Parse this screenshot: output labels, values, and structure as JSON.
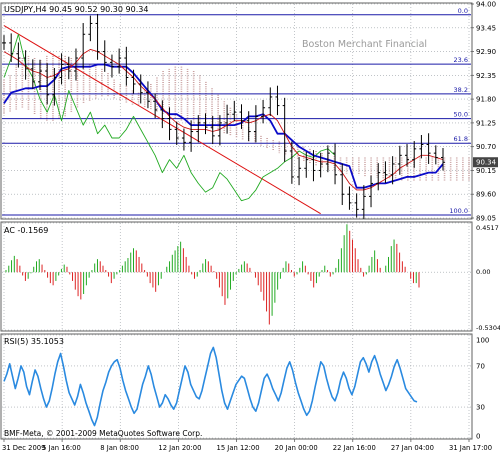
{
  "chart_data": {
    "type": "line",
    "title": "USDJPY,H4  90.45 90.52 90.30 90.34",
    "watermark": "Boston Merchant Financial",
    "copyright": "BMF-Meta, © 2001-2009 MetaQuotes Software Corp.",
    "x_labels": [
      "31 Dec 2009",
      "5 Jan 16:00",
      "8 Jan 08:00",
      "12 Jan 20:00",
      "15 Jan 12:00",
      "20 Jan 00:00",
      "22 Jan 16:00",
      "27 Jan 04:00",
      "31 Jan 17:00"
    ],
    "colors": {
      "background": "#ffffff",
      "grid": "#9aa0a6",
      "price_line": "#000000",
      "fib_level": "#1a1aa8",
      "kijun": "#0a0ac8",
      "tenkan": "#cc1111",
      "chikou": "#22aa22",
      "cloud": "#c9a0a0",
      "trendline": "#dd1111",
      "ac_up": "#22aa22",
      "ac_down": "#dd2222",
      "rsi": "#2a8ae0",
      "current_price_tag": "#444444"
    },
    "panels": {
      "price": {
        "ylim": [
          89.05,
          94.0
        ],
        "y_ticks": [
          "94.00",
          "93.45",
          "92.90",
          "92.35",
          "91.80",
          "91.25",
          "90.70",
          "90.15",
          "89.60",
          "89.05"
        ],
        "y_tick_values": [
          94.0,
          93.45,
          92.9,
          92.35,
          91.8,
          91.25,
          90.7,
          90.15,
          89.6,
          89.05
        ],
        "current_price": "90.34",
        "current_price_value": 90.34,
        "fib_levels": [
          {
            "label": "0.0",
            "price": 93.75
          },
          {
            "label": "23.6",
            "price": 92.61
          },
          {
            "label": "38.2",
            "price": 91.92
          },
          {
            "label": "50.0",
            "price": 91.35
          },
          {
            "label": "61.8",
            "price": 90.78
          },
          {
            "label": "100.0",
            "price": 89.12
          }
        ],
        "close": [
          93.1,
          92.85,
          92.75,
          92.5,
          92.2,
          92.45,
          91.9,
          92.3,
          92.6,
          92.45,
          92.75,
          93.3,
          93.55,
          92.9,
          92.65,
          92.55,
          92.75,
          92.3,
          92.15,
          91.95,
          91.75,
          91.55,
          91.35,
          91.1,
          90.9,
          90.8,
          91.05,
          91.25,
          91.15,
          90.95,
          91.25,
          91.45,
          91.5,
          91.3,
          91.05,
          91.4,
          91.6,
          91.85,
          91.65,
          90.6,
          90.0,
          90.2,
          90.4,
          90.15,
          90.3,
          90.55,
          90.05,
          89.6,
          89.4,
          89.25,
          89.55,
          89.85,
          90.1,
          90.05,
          90.3,
          90.5,
          90.4,
          90.65,
          90.75,
          90.55,
          90.45,
          90.34
        ],
        "tenkan": [
          92.9,
          92.8,
          92.7,
          92.55,
          92.45,
          92.4,
          92.3,
          92.35,
          92.45,
          92.5,
          92.65,
          92.85,
          92.95,
          92.9,
          92.8,
          92.7,
          92.6,
          92.45,
          92.3,
          92.1,
          91.95,
          91.8,
          91.6,
          91.4,
          91.25,
          91.15,
          91.1,
          91.1,
          91.1,
          91.05,
          91.1,
          91.2,
          91.3,
          91.3,
          91.25,
          91.3,
          91.4,
          91.45,
          91.3,
          91.0,
          90.7,
          90.5,
          90.45,
          90.4,
          90.35,
          90.35,
          90.3,
          90.1,
          89.85,
          89.7,
          89.7,
          89.75,
          89.85,
          89.95,
          90.05,
          90.2,
          90.3,
          90.4,
          90.5,
          90.5,
          90.45,
          90.4
        ],
        "kijun": [
          91.7,
          91.95,
          92.0,
          92.05,
          92.05,
          92.1,
          92.1,
          92.25,
          92.5,
          92.55,
          92.55,
          92.55,
          92.55,
          92.6,
          92.6,
          92.55,
          92.55,
          92.55,
          92.4,
          92.2,
          92.0,
          91.8,
          91.55,
          91.45,
          91.45,
          91.35,
          91.2,
          91.2,
          91.2,
          91.2,
          91.2,
          91.2,
          91.2,
          91.25,
          91.4,
          91.4,
          91.45,
          91.3,
          91.0,
          91.0,
          90.85,
          90.7,
          90.6,
          90.5,
          90.45,
          90.4,
          90.35,
          90.3,
          90.25,
          89.75,
          89.75,
          89.8,
          89.85,
          89.85,
          89.9,
          89.95,
          90.0,
          90.0,
          90.05,
          90.1,
          90.1,
          90.3
        ],
        "chikou": [
          92.3,
          92.75,
          93.3,
          92.6,
          92.3,
          91.8,
          91.5,
          91.9,
          91.3,
          92.0,
          91.6,
          91.2,
          91.5,
          91.0,
          91.2,
          90.9,
          90.9,
          91.1,
          91.4,
          91.1,
          90.8,
          90.5,
          90.1,
          90.4,
          90.2,
          90.5,
          90.1,
          89.85,
          89.65,
          89.75,
          90.1,
          89.95,
          89.7,
          89.45,
          89.5,
          89.7,
          90.0,
          90.1,
          90.2,
          90.35,
          90.45,
          90.6,
          90.5,
          90.45,
          90.6,
          90.65,
          90.5
        ],
        "cloud_upper": [
          92.25,
          92.35,
          92.6,
          92.75,
          92.8,
          92.75,
          92.7,
          92.8,
          92.85,
          92.8,
          92.8,
          92.75,
          92.7,
          92.55,
          92.6,
          92.55,
          92.5,
          92.4,
          92.25,
          92.15,
          92.1,
          92.0,
          91.95,
          92.0,
          92.15,
          92.3,
          92.45,
          92.5,
          92.55,
          92.55,
          92.5,
          92.45,
          92.35,
          92.2,
          92.05,
          91.9,
          91.75,
          91.6,
          91.45,
          91.3,
          91.15,
          91.05,
          90.95,
          90.9,
          90.85,
          90.82,
          90.8,
          90.78,
          90.75,
          90.7,
          90.65,
          90.6,
          90.55,
          90.5,
          90.48,
          90.45,
          90.45,
          90.45,
          90.45,
          90.45,
          90.45,
          90.45,
          90.45,
          90.45,
          90.45,
          90.45,
          90.45,
          90.45,
          90.45,
          90.45,
          90.45,
          90.45,
          90.45,
          90.45,
          90.45,
          90.45,
          90.45
        ],
        "cloud_lower": [
          91.45,
          91.5,
          91.55,
          91.6,
          91.55,
          91.45,
          91.35,
          91.3,
          91.3,
          91.35,
          91.4,
          91.5,
          91.6,
          91.7,
          91.75,
          91.8,
          91.85,
          91.85,
          91.8,
          91.75,
          91.7,
          91.65,
          91.65,
          91.6,
          91.55,
          91.5,
          91.45,
          91.4,
          91.35,
          91.3,
          91.25,
          91.2,
          91.2,
          91.15,
          91.1,
          91.05,
          91.0,
          90.95,
          90.9,
          90.85,
          90.8,
          90.75,
          90.7,
          90.65,
          90.6,
          90.55,
          90.5,
          90.45,
          90.4,
          90.35,
          90.3,
          90.25,
          90.2,
          90.15,
          90.12,
          90.1,
          90.08,
          90.06,
          90.04,
          90.02,
          90.0,
          89.98,
          89.96,
          89.94,
          89.93,
          89.92,
          89.91,
          89.9,
          89.9,
          89.9,
          89.9,
          89.9,
          89.9,
          89.9,
          89.9,
          89.9,
          89.9
        ],
        "trendline": {
          "start": [
            0,
            93.5
          ],
          "end": [
            44,
            89.15
          ]
        }
      },
      "ac": {
        "label": "AC -0.1569",
        "ylim": [
          -0.5304,
          0.4517
        ],
        "y_ticks": [
          "0.4517",
          "0.00",
          "-0.5304"
        ],
        "y_tick_values": [
          0.4517,
          0.0,
          -0.5304
        ],
        "values": [
          0.02,
          0.06,
          0.11,
          0.15,
          0.12,
          0.06,
          -0.03,
          -0.08,
          -0.06,
          -0.01,
          0.05,
          0.1,
          0.12,
          0.07,
          0.02,
          -0.05,
          -0.1,
          -0.12,
          -0.08,
          -0.03,
          0.03,
          0.07,
          0.05,
          -0.02,
          -0.08,
          -0.16,
          -0.22,
          -0.25,
          -0.2,
          -0.12,
          -0.05,
          0.02,
          0.08,
          0.12,
          0.1,
          0.06,
          0.02,
          -0.04,
          -0.1,
          -0.06,
          -0.02,
          0.02,
          0.06,
          0.1,
          0.13,
          0.18,
          0.22,
          0.2,
          0.14,
          0.08,
          0.02,
          -0.04,
          -0.1,
          -0.14,
          -0.18,
          -0.12,
          -0.06,
          0.0,
          0.05,
          0.1,
          0.16,
          0.2,
          0.24,
          0.28,
          0.22,
          0.14,
          0.06,
          -0.02,
          -0.06,
          -0.04,
          0.02,
          0.08,
          0.12,
          0.1,
          0.06,
          0.01,
          -0.06,
          -0.14,
          -0.22,
          -0.3,
          -0.24,
          -0.16,
          -0.08,
          -0.02,
          0.03,
          0.07,
          0.1,
          0.08,
          0.04,
          0.0,
          -0.05,
          -0.12,
          -0.18,
          -0.26,
          -0.36,
          -0.48,
          -0.4,
          -0.28,
          -0.16,
          -0.06,
          0.04,
          0.1,
          0.08,
          0.02,
          -0.04,
          -0.02,
          0.04,
          0.1,
          0.06,
          -0.02,
          -0.08,
          -0.14,
          -0.1,
          -0.04,
          0.02,
          0.06,
          0.02,
          -0.04,
          -0.02,
          0.04,
          0.12,
          0.22,
          0.34,
          0.44,
          0.38,
          0.3,
          0.22,
          0.12,
          0.04,
          -0.04,
          -0.02,
          0.06,
          0.14,
          0.2,
          0.12,
          0.04,
          0.0,
          0.06,
          0.14,
          0.24,
          0.3,
          0.26,
          0.18,
          0.1,
          0.05,
          0.0,
          -0.06,
          -0.1,
          -0.1,
          -0.14
        ]
      },
      "rsi": {
        "label": "RSI(5) 35.1053",
        "ylim": [
          0,
          100
        ],
        "y_ticks": [
          "100",
          "70",
          "30",
          "0"
        ],
        "y_tick_values": [
          100,
          70,
          30,
          0
        ],
        "values": [
          55,
          62,
          72,
          60,
          48,
          58,
          70,
          64,
          50,
          42,
          55,
          66,
          60,
          48,
          38,
          30,
          36,
          48,
          62,
          74,
          82,
          70,
          56,
          44,
          38,
          32,
          40,
          52,
          44,
          34,
          26,
          18,
          12,
          20,
          34,
          46,
          54,
          64,
          70,
          74,
          76,
          68,
          56,
          46,
          38,
          30,
          24,
          28,
          40,
          52,
          60,
          70,
          62,
          50,
          40,
          30,
          34,
          42,
          38,
          32,
          28,
          34,
          46,
          58,
          70,
          64,
          52,
          46,
          40,
          38,
          46,
          58,
          70,
          82,
          88,
          78,
          62,
          46,
          34,
          28,
          36,
          44,
          52,
          56,
          60,
          58,
          48,
          38,
          30,
          26,
          34,
          46,
          58,
          62,
          56,
          48,
          42,
          36,
          44,
          56,
          68,
          74,
          66,
          54,
          44,
          36,
          28,
          22,
          26,
          36,
          50,
          62,
          74,
          70,
          58,
          48,
          40,
          36,
          44,
          56,
          64,
          58,
          48,
          42,
          50,
          62,
          74,
          78,
          72,
          64,
          74,
          80,
          72,
          62,
          54,
          46,
          52,
          60,
          70,
          76,
          68,
          58,
          48,
          44,
          40,
          36,
          35
        ]
      }
    }
  }
}
